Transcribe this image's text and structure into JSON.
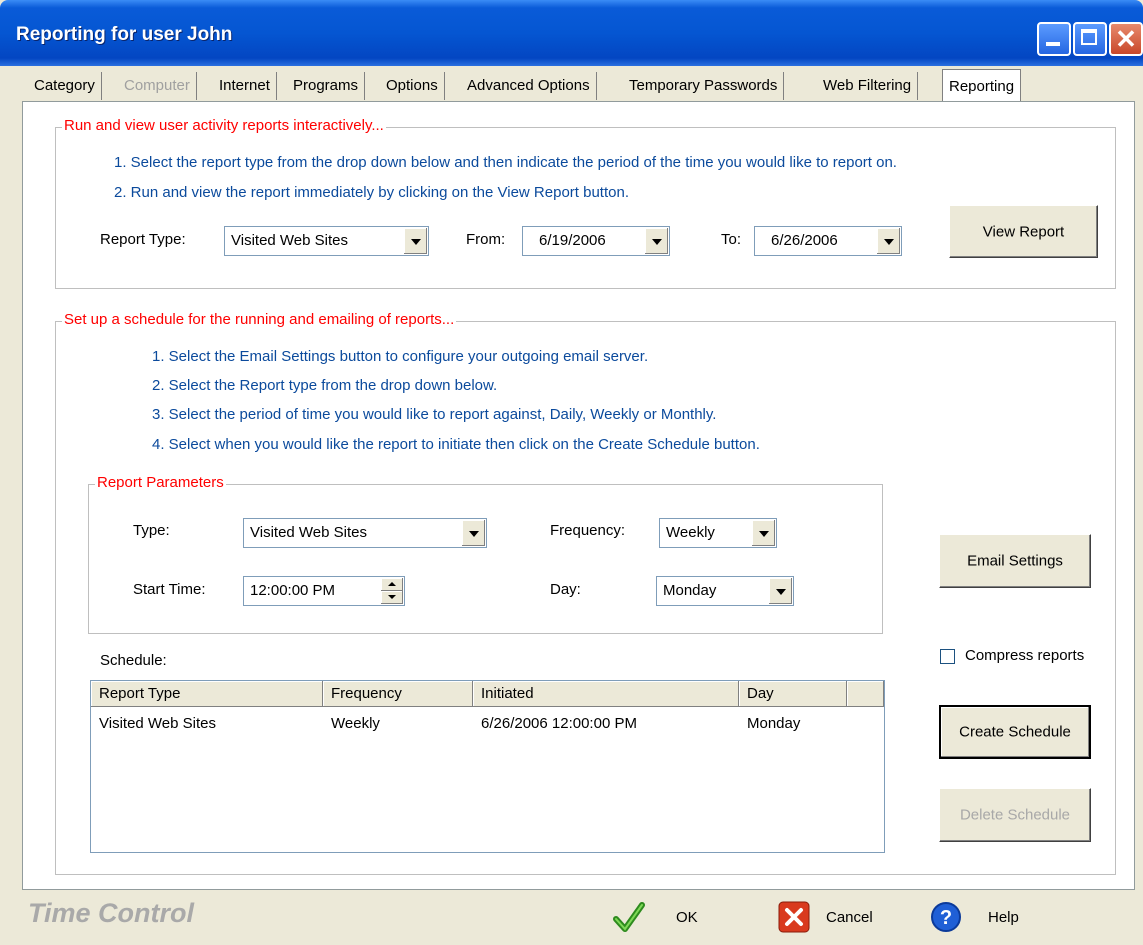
{
  "window": {
    "title": "Reporting for user John"
  },
  "tabs": [
    {
      "label": "Category",
      "state": "normal"
    },
    {
      "label": "Computer",
      "state": "disabled"
    },
    {
      "label": "Internet",
      "state": "normal"
    },
    {
      "label": "Programs",
      "state": "normal"
    },
    {
      "label": "Options",
      "state": "normal"
    },
    {
      "label": "Advanced Options",
      "state": "normal"
    },
    {
      "label": "Temporary Passwords",
      "state": "normal"
    },
    {
      "label": "Web Filtering",
      "state": "normal"
    },
    {
      "label": "Reporting",
      "state": "active"
    }
  ],
  "interactive": {
    "legend": "Run and view user activity reports interactively...",
    "step1": "1. Select the report type from the drop down below and then indicate the period of the time you would like to report on.",
    "step2": "2. Run and view the report immediately by clicking on the View Report button.",
    "report_type_label": "Report Type:",
    "report_type_value": "Visited Web Sites",
    "from_label": "From:",
    "from_value": "6/19/2006",
    "to_label": "To:",
    "to_value": "6/26/2006",
    "view_report_label": "View Report"
  },
  "schedule_group": {
    "legend": "Set up a schedule for the running and emailing of reports...",
    "step1": "1. Select the Email Settings button to configure your outgoing email  server.",
    "step2": "2. Select the Report type from the drop down below.",
    "step3": "3. Select the period of time you would like to report against, Daily, Weekly or Monthly.",
    "step4": "4. Select when you would like the report to initiate then click on the Create Schedule button.",
    "params": {
      "legend": "Report Parameters",
      "type_label": "Type:",
      "type_value": "Visited Web Sites",
      "frequency_label": "Frequency:",
      "frequency_value": "Weekly",
      "start_time_label": "Start Time:",
      "start_time_value": "12:00:00 PM",
      "day_label": "Day:",
      "day_value": "Monday"
    },
    "email_settings_label": "Email Settings",
    "compress_label": "Compress reports",
    "compress_checked": false,
    "schedule_label": "Schedule:",
    "columns": [
      "Report Type",
      "Frequency",
      "Initiated",
      "Day"
    ],
    "rows": [
      [
        "Visited Web Sites",
        "Weekly",
        "6/26/2006 12:00:00 PM",
        "Monday"
      ]
    ],
    "create_schedule_label": "Create Schedule",
    "delete_schedule_label": "Delete Schedule"
  },
  "footer": {
    "brand": "Time Control",
    "ok_label": "OK",
    "cancel_label": "Cancel",
    "help_label": "Help"
  },
  "colors": {
    "legend_red": "#FF0000",
    "instruction_blue": "#0B4A9C",
    "window_face": "#ECE9D8"
  }
}
